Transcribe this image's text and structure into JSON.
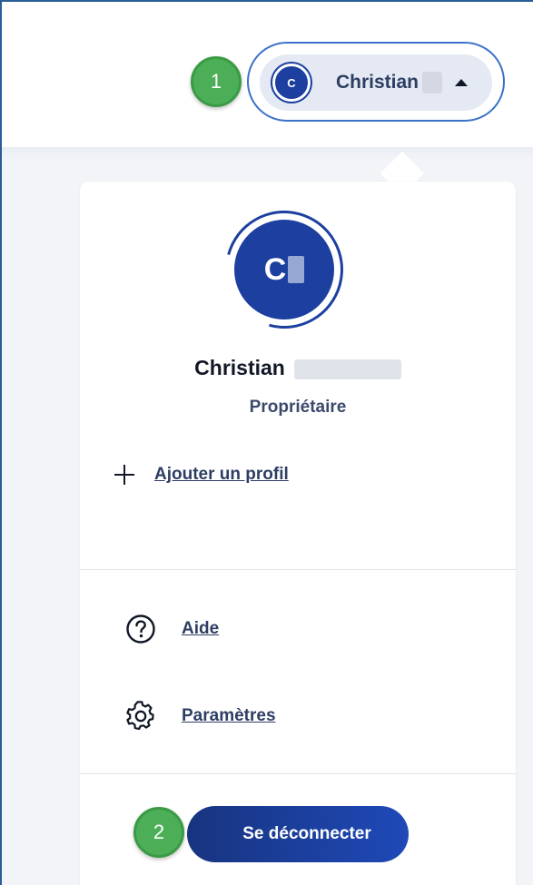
{
  "header": {
    "step_badge_1": "1",
    "user_trigger": {
      "avatar_initials": "C",
      "name": "Christian",
      "caret_icon": "caret-up-icon"
    }
  },
  "dropdown": {
    "avatar_initial": "C",
    "profile_name": "Christian",
    "profile_role": "Propriétaire",
    "add_profile_label": "Ajouter un profil",
    "add_profile_icon": "plus-icon",
    "menu": [
      {
        "label": "Aide",
        "icon": "help-circle-icon"
      },
      {
        "label": "Paramètres",
        "icon": "gear-icon"
      }
    ],
    "step_badge_2": "2",
    "logout_label": "Se déconnecter"
  },
  "colors": {
    "accent_blue": "#1c3fa0",
    "badge_green": "#4caf58",
    "text_dark": "#111827",
    "text_link": "#2d3e63"
  }
}
